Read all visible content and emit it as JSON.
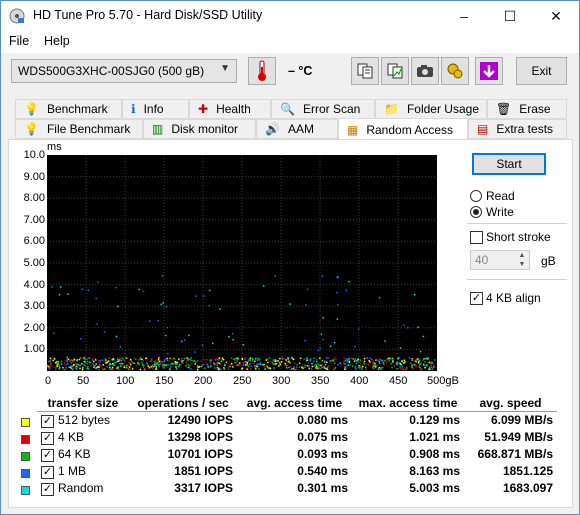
{
  "window": {
    "title": "HD Tune Pro 5.70 - Hard Disk/SSD Utility",
    "min": "–",
    "max": "☐",
    "close": "✕"
  },
  "menu": {
    "file": "File",
    "help": "Help"
  },
  "toolbar": {
    "drive": "WDS500G3XHC-00SJG0 (500 gB)",
    "temp": "– °C",
    "exit": "Exit"
  },
  "tabs_row1": [
    "Benchmark",
    "Info",
    "Health",
    "Error Scan",
    "Folder Usage",
    "Erase"
  ],
  "tabs_row2": [
    "File Benchmark",
    "Disk monitor",
    "AAM",
    "Random Access",
    "Extra tests"
  ],
  "chart": {
    "unit": "ms",
    "yticks": [
      "10.0",
      "9.00",
      "8.00",
      "7.00",
      "6.00",
      "5.00",
      "4.00",
      "3.00",
      "2.00",
      "1.00"
    ],
    "xticks": [
      "0",
      "50",
      "100",
      "150",
      "200",
      "250",
      "300",
      "350",
      "400",
      "450",
      "500gB"
    ]
  },
  "controls": {
    "start": "Start",
    "read": "Read",
    "write": "Write",
    "short_stroke": "Short stroke",
    "stroke_value": "40",
    "stroke_unit": "gB",
    "align": "4 KB align",
    "selected_mode": "Write"
  },
  "table": {
    "headers": [
      "transfer size",
      "operations / sec",
      "avg. access time",
      "max. access time",
      "avg. speed"
    ],
    "rows": [
      {
        "size": "512 bytes",
        "ops": "12490 IOPS",
        "avg": "0.080 ms",
        "max": "0.129 ms",
        "speed": "6.099 MB/s",
        "color": "#ffff00"
      },
      {
        "size": "4 KB",
        "ops": "13298 IOPS",
        "avg": "0.075 ms",
        "max": "1.021 ms",
        "speed": "51.949 MB/s",
        "color": "#e00000"
      },
      {
        "size": "64 KB",
        "ops": "10701 IOPS",
        "avg": "0.093 ms",
        "max": "0.908 ms",
        "speed": "668.871 MB/s",
        "color": "#00c000"
      },
      {
        "size": "1 MB",
        "ops": "1851 IOPS",
        "avg": "0.540 ms",
        "max": "8.163 ms",
        "speed": "1851.125",
        "color": "#1e64ff"
      },
      {
        "size": "Random",
        "ops": "3317 IOPS",
        "avg": "0.301 ms",
        "max": "5.003 ms",
        "speed": "1683.097",
        "color": "#00e0e0"
      }
    ]
  }
}
